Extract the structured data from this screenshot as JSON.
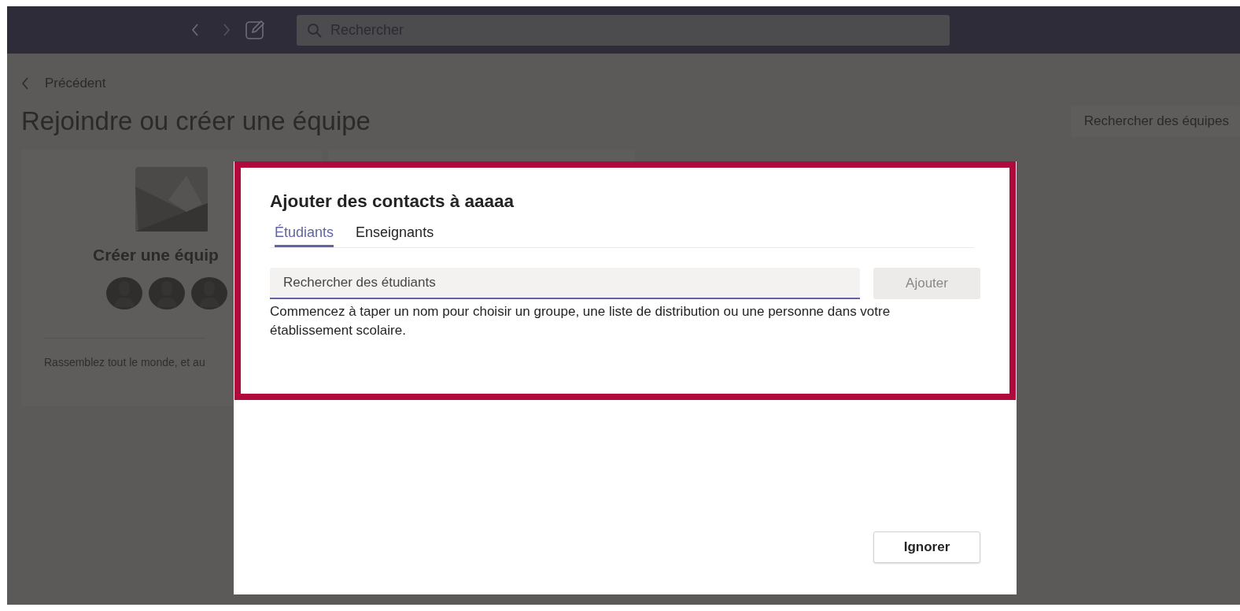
{
  "top_bar": {
    "search": {
      "placeholder": "Rechercher"
    }
  },
  "back_link": "Précédent",
  "page_title": "Rejoindre ou créer une équipe",
  "search_teams_button": "Rechercher des équipes",
  "create_card": {
    "title": "Créer une équip",
    "description": "Rassemblez tout le monde, et au"
  },
  "dialog": {
    "title": "Ajouter des contacts à aaaaa",
    "tabs": [
      {
        "label": "Étudiants",
        "selected": true
      },
      {
        "label": "Enseignants",
        "selected": false
      }
    ],
    "search": {
      "placeholder": "Rechercher des étudiants"
    },
    "add_button": {
      "label": "Ajouter",
      "disabled": true
    },
    "help": "Commencez à taper un nom pour choisir un groupe, une liste de distribution ou une personne dans votre établissement scolaire.",
    "ignore_button": "Ignorer"
  }
}
